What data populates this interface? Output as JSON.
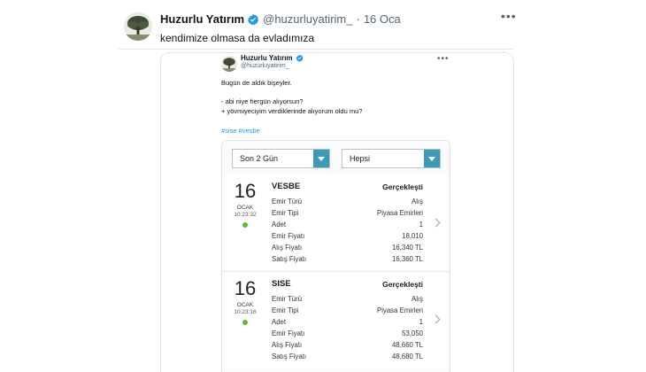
{
  "tweet": {
    "display_name": "Huzurlu Yatırım",
    "handle": "@huzurluyatirim_",
    "separator": "·",
    "date": "16 Oca",
    "text": "kendimize olmasa da evladımıza",
    "more_icon": "more-horizontal-icon",
    "verified_color": "#1d9bf0"
  },
  "quote": {
    "display_name": "Huzurlu Yatırım",
    "handle": "@huzurluyatirim_",
    "lines": [
      "Bugün de aldık bişeyler.",
      "- abi niye hergün alıyorsun?",
      "+ yövmiyeciyim verdiklerinde alıyorum oldu mu?"
    ],
    "tags": "#sise #vesbe"
  },
  "app": {
    "filter_period": "Son 2 Gün",
    "filter_type": "Hepsi",
    "accent_color": "#3a9bb4",
    "labels": [
      "Emir Türü",
      "Emir Tipi",
      "Adet",
      "Emir Fiyatı",
      "Alış Fiyatı",
      "Satış Fiyatı"
    ],
    "orders": [
      {
        "day": "16",
        "month": "OCAK",
        "time": "10:23:32",
        "symbol": "VESBE",
        "status": "Gerçekleşti",
        "values": [
          "Alış",
          "Piyasa Emirleri",
          "1",
          "18,010",
          "16,340 TL",
          "16,360 TL"
        ]
      },
      {
        "day": "16",
        "month": "OCAK",
        "time": "10:23:16",
        "symbol": "SISE",
        "status": "Gerçekleşti",
        "values": [
          "Alış",
          "Piyasa Emirleri",
          "1",
          "53,050",
          "48,660 TL",
          "48,680 TL"
        ]
      }
    ]
  }
}
